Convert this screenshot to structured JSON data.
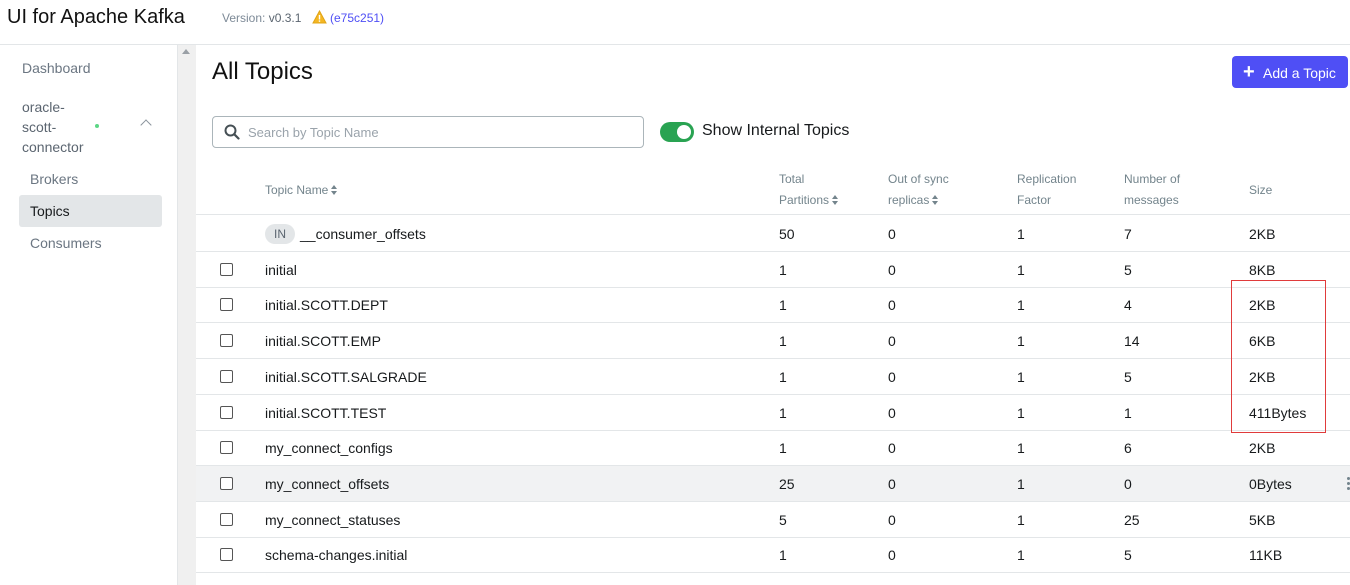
{
  "header": {
    "title": "UI for Apache Kafka",
    "version_label": "Version:",
    "version": "v0.3.1",
    "commit": "(e75c251)"
  },
  "sidebar": {
    "dashboard": "Dashboard",
    "cluster": "oracle-scott-connector",
    "items": [
      "Brokers",
      "Topics",
      "Consumers"
    ],
    "active": "Topics"
  },
  "main": {
    "title": "All Topics",
    "add_button": "Add a Topic",
    "search_placeholder": "Search by Topic Name",
    "toggle_label": "Show Internal Topics",
    "toggle_on": true
  },
  "table": {
    "columns": {
      "name": "Topic Name",
      "partitions_1": "Total",
      "partitions_2": "Partitions",
      "oos_1": "Out of sync",
      "oos_2": "replicas",
      "rf_1": "Replication",
      "rf_2": "Factor",
      "msgs_1": "Number of",
      "msgs_2": "messages",
      "size": "Size"
    },
    "rows": [
      {
        "internal": true,
        "badge": "IN",
        "name": "__consumer_offsets",
        "partitions": "50",
        "oos": "0",
        "rf": "1",
        "messages": "7",
        "size": "2KB"
      },
      {
        "internal": false,
        "name": "initial",
        "partitions": "1",
        "oos": "0",
        "rf": "1",
        "messages": "5",
        "size": "8KB"
      },
      {
        "internal": false,
        "name": "initial.SCOTT.DEPT",
        "partitions": "1",
        "oos": "0",
        "rf": "1",
        "messages": "4",
        "size": "2KB"
      },
      {
        "internal": false,
        "name": "initial.SCOTT.EMP",
        "partitions": "1",
        "oos": "0",
        "rf": "1",
        "messages": "14",
        "size": "6KB"
      },
      {
        "internal": false,
        "name": "initial.SCOTT.SALGRADE",
        "partitions": "1",
        "oos": "0",
        "rf": "1",
        "messages": "5",
        "size": "2KB"
      },
      {
        "internal": false,
        "name": "initial.SCOTT.TEST",
        "partitions": "1",
        "oos": "0",
        "rf": "1",
        "messages": "1",
        "size": "411Bytes"
      },
      {
        "internal": false,
        "name": "my_connect_configs",
        "partitions": "1",
        "oos": "0",
        "rf": "1",
        "messages": "6",
        "size": "2KB"
      },
      {
        "internal": false,
        "name": "my_connect_offsets",
        "partitions": "25",
        "oos": "0",
        "rf": "1",
        "messages": "0",
        "size": "0Bytes",
        "hovered": true
      },
      {
        "internal": false,
        "name": "my_connect_statuses",
        "partitions": "5",
        "oos": "0",
        "rf": "1",
        "messages": "25",
        "size": "5KB"
      },
      {
        "internal": false,
        "name": "schema-changes.initial",
        "partitions": "1",
        "oos": "0",
        "rf": "1",
        "messages": "5",
        "size": "11KB"
      }
    ]
  },
  "colors": {
    "accent": "#4f4ff5",
    "toggle_on": "#29a352",
    "annotation": "#e03b3b"
  }
}
